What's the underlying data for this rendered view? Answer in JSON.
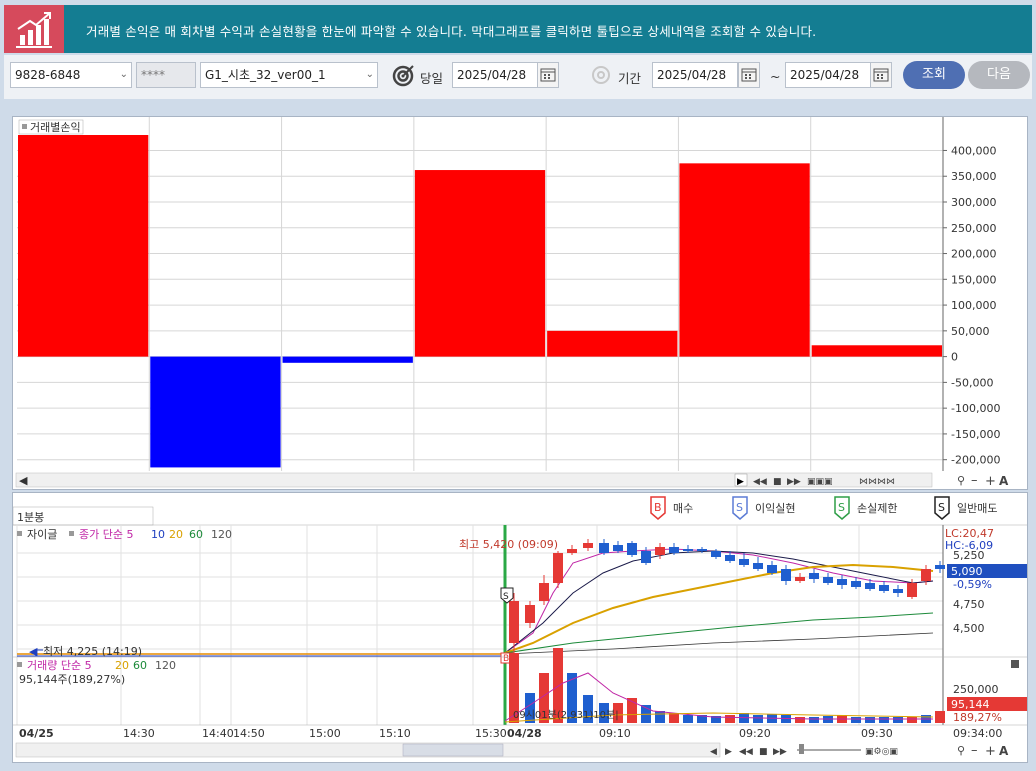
{
  "info": {
    "text": "거래별 손익은 매 회차별 수익과 손실현황을 한눈에 파악할 수 있습니다. 막대그래프를 클릭하면 툴팁으로 상세내역을 조회할 수 있습니다."
  },
  "toolbar": {
    "account": "9828-6848",
    "password": "****",
    "strategy": "G1_시초_32_ver00_1",
    "today_label": "당일",
    "today_date": "2025/04/28",
    "period_label": "기간",
    "from_date": "2025/04/28",
    "tilde": "~",
    "to_date": "2025/04/28",
    "search": "조회",
    "next": "다음"
  },
  "pnl_chart": {
    "title": "거래별손익",
    "yticks": [
      "400,000",
      "350,000",
      "300,000",
      "250,000",
      "200,000",
      "150,000",
      "100,000",
      "50,000",
      "0",
      "-50,000",
      "-100,000",
      "-150,000",
      "-200,000"
    ]
  },
  "chart_data": {
    "type": "bar",
    "title": "거래별손익",
    "values": [
      430000,
      -215000,
      -12000,
      362000,
      50000,
      375000,
      22000
    ],
    "colors": {
      "profit": "#ff0000",
      "loss": "#0000ff"
    },
    "ylim": [
      -220000,
      430000
    ]
  },
  "candle_panel": {
    "tab": "1분봉",
    "legend": {
      "stock": "자이글",
      "ma": "종가 단순 5",
      "p10": "10",
      "p20": "20",
      "p60": "60",
      "p120": "120"
    },
    "volume_legend": {
      "label": "거래량 단순 5",
      "p20": "20",
      "p60": "60",
      "p120": "120",
      "value": "95,144주(189,27%)"
    },
    "high": "최고 5,420 (09:09)",
    "low": "최저 4,225 (14:19)",
    "lc": "LC:20,47",
    "hc": "HC:-6,09",
    "price_ticks": [
      "5,250",
      "4,750",
      "4,500"
    ],
    "current_price": "5,090",
    "current_change": "-0,59%",
    "vol_tick": "250,000",
    "vol_current": "95,144",
    "vol_pct": "189,27%",
    "overlay_text": "09시01분(2,931)10분|",
    "time_labels": [
      "04/25",
      "14:30",
      "14:40",
      "14:50",
      "15:00",
      "15:10",
      "15:30",
      "04/28",
      "09:10",
      "09:20",
      "09:30"
    ],
    "last_time": "09:34:00"
  },
  "signal_legend": [
    {
      "badge": "B",
      "label": "매수",
      "color": "#e53935"
    },
    {
      "badge": "S",
      "label": "이익실현",
      "color": "#5b7bd5"
    },
    {
      "badge": "S",
      "label": "손실제한",
      "color": "#2e9e47"
    },
    {
      "badge": "S",
      "label": "일반매도",
      "color": "#222222"
    }
  ]
}
